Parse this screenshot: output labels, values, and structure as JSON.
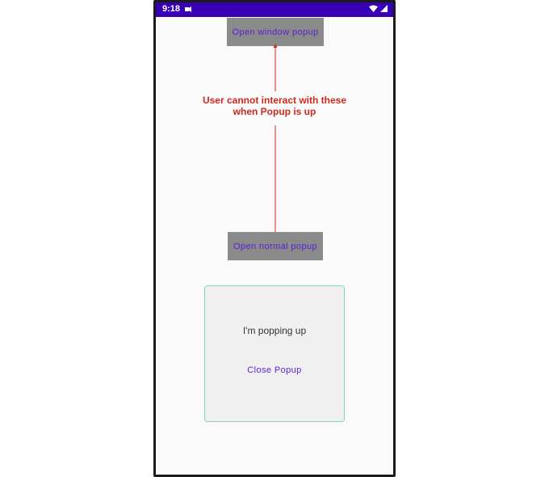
{
  "status_bar": {
    "time": "9:18",
    "background_color": "#3700b3",
    "icons": [
      "notification-icon",
      "wifi-icon",
      "signal-icon"
    ]
  },
  "buttons": {
    "open_window_popup": "Open window popup",
    "open_normal_popup": "Open normal popup"
  },
  "annotation": {
    "text": "User cannot interact with these when Popup is up",
    "color": "#cc2a1c"
  },
  "popup": {
    "message": "I'm popping up",
    "close_label": "Close Popup",
    "border_color": "#7fd6c0"
  },
  "colors": {
    "accent": "#5b21d6",
    "button_background": "#8a8a8a",
    "screen_background": "#fafafa"
  }
}
